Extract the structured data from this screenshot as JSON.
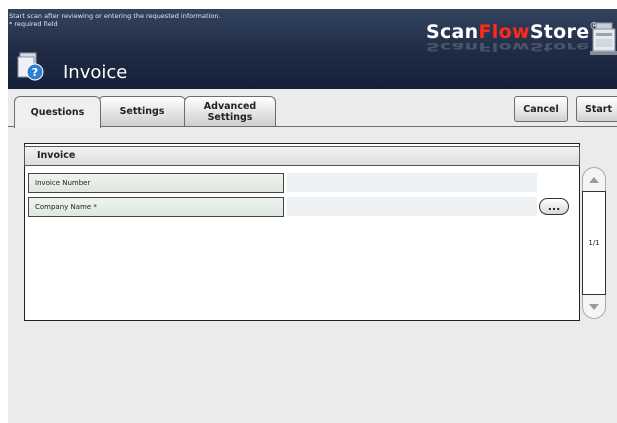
{
  "header": {
    "instruction_line1": "Start scan after reviewing or entering the requested information.",
    "instruction_line2": "* required field",
    "app_title": "Invoice",
    "logo_part1": "Scan",
    "logo_part2": "Flow",
    "logo_part3": "Store",
    "logo_mark": "®"
  },
  "tabs": [
    {
      "label": "Questions",
      "active": true
    },
    {
      "label": "Settings",
      "active": false
    },
    {
      "label": "Advanced Settings",
      "active": false
    }
  ],
  "actions": {
    "cancel_label": "Cancel",
    "start_label": "Start"
  },
  "form": {
    "section_title": "Invoice",
    "fields": [
      {
        "label": "Invoice Number",
        "value": ""
      },
      {
        "label": "Company Name *",
        "value": ""
      }
    ],
    "browse_label": "..."
  },
  "pager": {
    "page_indicator": "1/1"
  },
  "colors": {
    "header_bg": "#1f2b44",
    "logo_accent": "#ff2a1a",
    "content_bg": "#ebebeb"
  },
  "icons": [
    "help-document-icon",
    "scanner-icon",
    "scroll-up-icon",
    "scroll-down-icon"
  ]
}
